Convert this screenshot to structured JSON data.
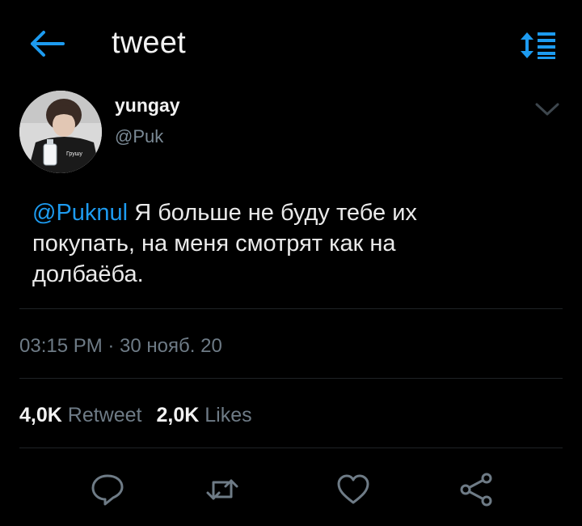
{
  "header": {
    "title": "tweet",
    "back_icon": "arrow-left-icon",
    "sort_icon": "sort-icon"
  },
  "tweet": {
    "author_name": "yungay",
    "author_handle": "@Puk",
    "mention": "@Puknul",
    "text_line_1": "Я больше не буду тебе их",
    "text_line_2": "покупать, на меня смотрят как на",
    "text_line_3": "долбаёба.",
    "timestamp": "03:15 PM · 30 нояб. 20",
    "avatar_caption": "Грушу"
  },
  "stats": {
    "retweets_count": "4,0K",
    "retweets_label": "Retweet",
    "likes_count": "2,0K",
    "likes_label": "Likes"
  },
  "actions": [
    {
      "icon": "reply-icon"
    },
    {
      "icon": "retweet-icon"
    },
    {
      "icon": "heart-icon"
    },
    {
      "icon": "share-icon"
    }
  ],
  "colors": {
    "background": "#000000",
    "accent": "#1d9bf0",
    "muted": "#6e7b86",
    "text": "#eaeaea"
  }
}
